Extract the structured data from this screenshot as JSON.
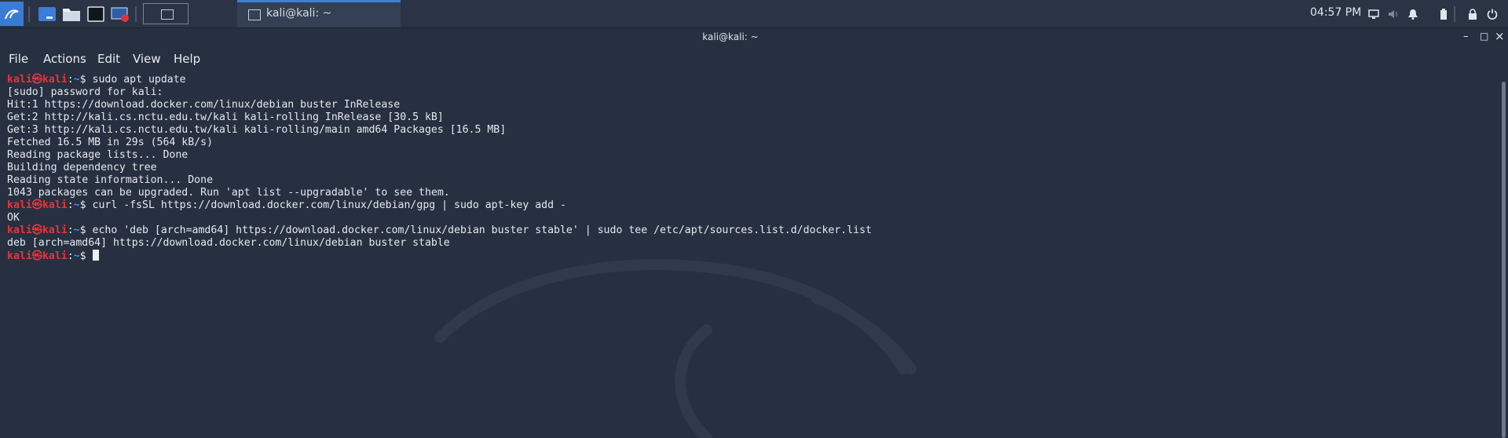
{
  "panel": {
    "menu_icon": "kali-dragon-icon",
    "launchers": [
      "show-desktop-icon",
      "file-manager-icon",
      "terminal-icon",
      "screen-recorder-icon"
    ],
    "task_title": "kali@kali: ~",
    "clock": "04:57 PM",
    "tray": [
      "display-icon",
      "volume-icon",
      "notification-bell-icon",
      "battery-icon",
      "lock-icon",
      "power-icon"
    ]
  },
  "window": {
    "title": "kali@kali: ~",
    "controls": {
      "minimize": "–",
      "maximize": "□",
      "close": "×"
    },
    "menus": [
      "File",
      "Actions",
      "Edit",
      "View",
      "Help"
    ]
  },
  "prompt": {
    "user": "kali㉿kali",
    "sep": ":",
    "path": "~",
    "symbol": "$"
  },
  "terminal_lines": [
    {
      "type": "cmd",
      "text": " sudo apt update"
    },
    {
      "type": "out",
      "text": "[sudo] password for kali:"
    },
    {
      "type": "out",
      "text": "Hit:1 https://download.docker.com/linux/debian buster InRelease"
    },
    {
      "type": "out",
      "text": "Get:2 http://kali.cs.nctu.edu.tw/kali kali-rolling InRelease [30.5 kB]"
    },
    {
      "type": "out",
      "text": "Get:3 http://kali.cs.nctu.edu.tw/kali kali-rolling/main amd64 Packages [16.5 MB]"
    },
    {
      "type": "out",
      "text": "Fetched 16.5 MB in 29s (564 kB/s)"
    },
    {
      "type": "out",
      "text": "Reading package lists... Done"
    },
    {
      "type": "out",
      "text": "Building dependency tree"
    },
    {
      "type": "out",
      "text": "Reading state information... Done"
    },
    {
      "type": "out",
      "text": "1043 packages can be upgraded. Run 'apt list --upgradable' to see them."
    },
    {
      "type": "cmd",
      "text": " curl -fsSL https://download.docker.com/linux/debian/gpg | sudo apt-key add -"
    },
    {
      "type": "out",
      "text": "OK"
    },
    {
      "type": "cmd",
      "text": " echo 'deb [arch=amd64] https://download.docker.com/linux/debian buster stable' | sudo tee /etc/apt/sources.list.d/docker.list"
    },
    {
      "type": "out",
      "text": "deb [arch=amd64] https://download.docker.com/linux/debian buster stable"
    },
    {
      "type": "cmd",
      "text": " "
    }
  ],
  "colors": {
    "background": "#263040",
    "user": "#e8333b",
    "path": "#3d8ff0",
    "accent": "#3f7fd6"
  }
}
